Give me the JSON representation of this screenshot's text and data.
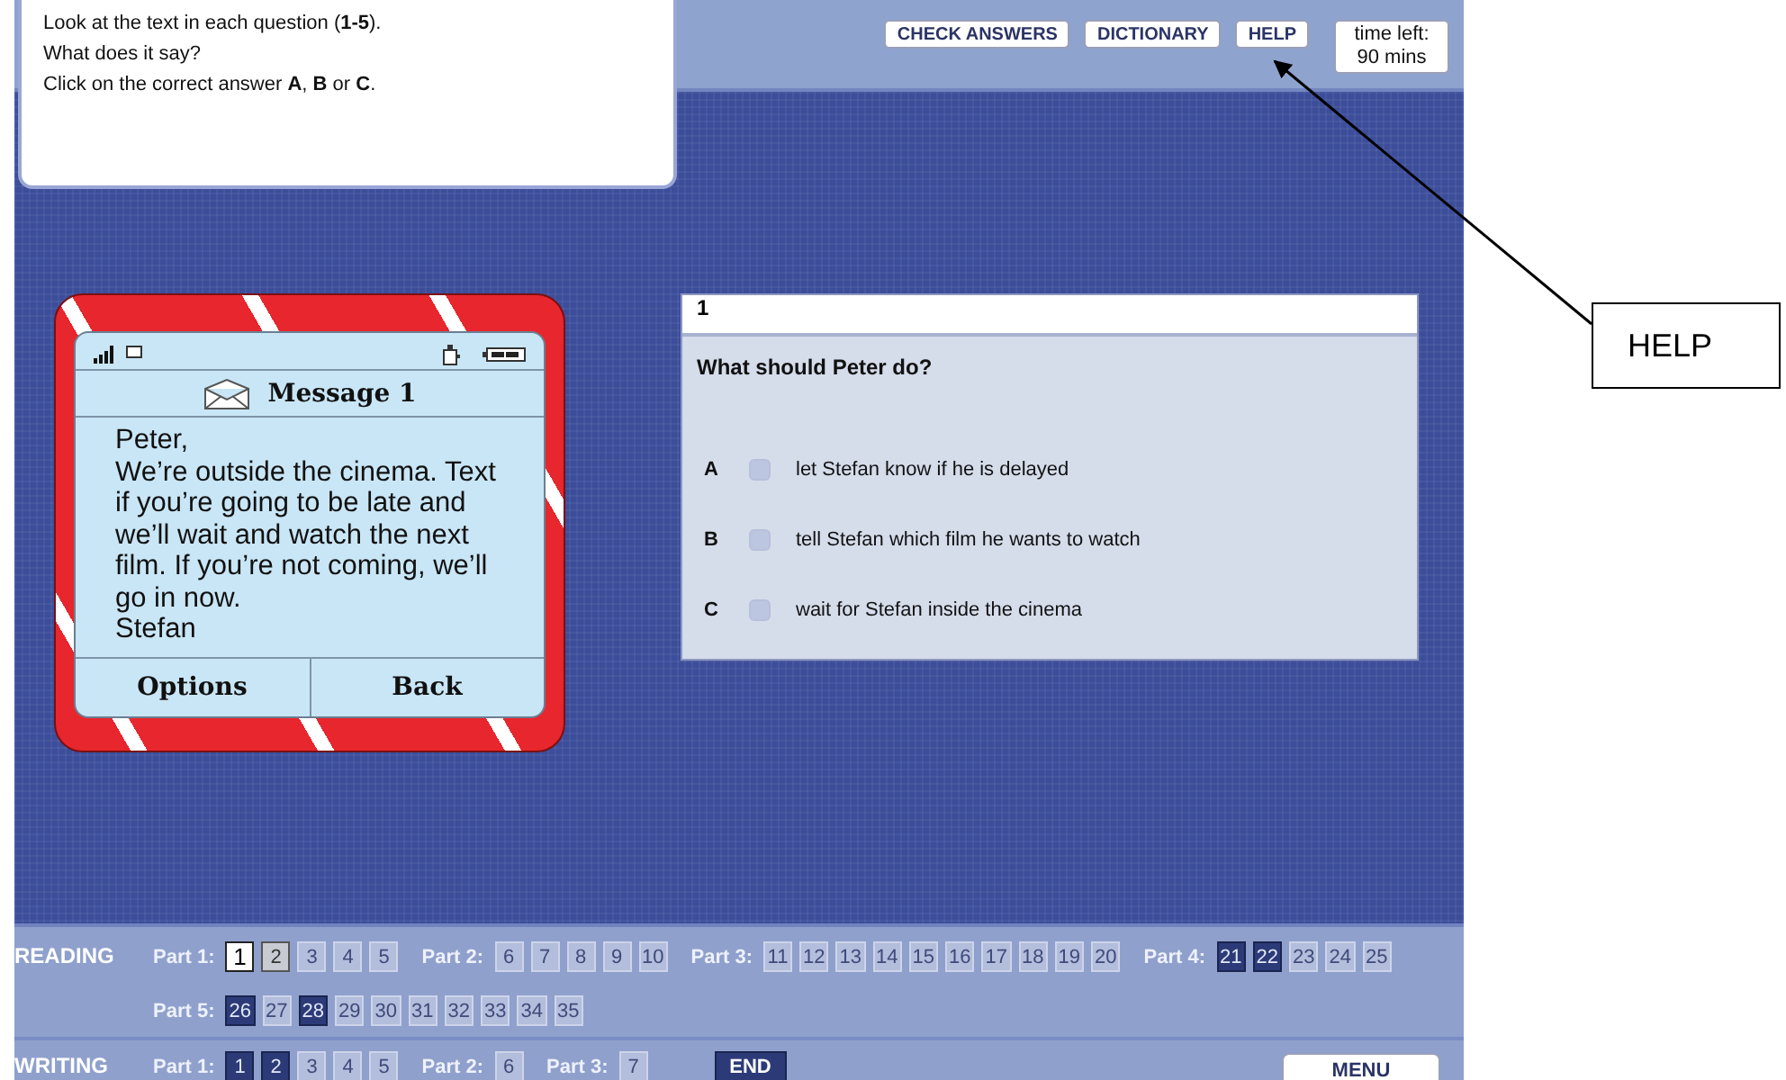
{
  "instructions": [
    "Look at the text in each question (**1-5**).",
    "What does it say?",
    "Click on the correct answer **A**, **B** or **C**."
  ],
  "toolbar": {
    "buttons": [
      "CHECK ANSWERS",
      "DICTIONARY",
      "HELP"
    ],
    "timer": [
      "time left:",
      "90 mins"
    ]
  },
  "phone": {
    "title": "Message 1",
    "message": [
      "Peter,",
      "We’re outside the cinema. Text if you’re going to be late and we’ll wait and watch the next film. If you’re not coming, we’ll go in now.",
      "Stefan"
    ],
    "softkeys": [
      "Options",
      "Back"
    ]
  },
  "question": {
    "number": "1",
    "prompt": "What should Peter do?",
    "options": [
      {
        "letter": "A",
        "text": "let Stefan know if he is delayed",
        "selected": false
      },
      {
        "letter": "B",
        "text": "tell Stefan which film he wants to watch",
        "selected": false
      },
      {
        "letter": "C",
        "text": "wait for Stefan inside the cinema",
        "selected": false
      }
    ]
  },
  "navigation": {
    "reading": {
      "label": "READING",
      "parts": [
        {
          "label": "Part 1:",
          "items": [
            {
              "n": "1",
              "selected": true,
              "visited": true,
              "answered": false
            },
            {
              "n": "2",
              "selected": false,
              "visited": true,
              "answered": false
            },
            {
              "n": "3",
              "selected": false,
              "visited": false,
              "answered": false
            },
            {
              "n": "4",
              "selected": false,
              "visited": false,
              "answered": false
            },
            {
              "n": "5",
              "selected": false,
              "visited": false,
              "answered": false
            }
          ]
        },
        {
          "label": "Part 2:",
          "items": [
            {
              "n": "6",
              "selected": false,
              "visited": false,
              "answered": false
            },
            {
              "n": "7",
              "selected": false,
              "visited": false,
              "answered": false
            },
            {
              "n": "8",
              "selected": false,
              "visited": false,
              "answered": false
            },
            {
              "n": "9",
              "selected": false,
              "visited": false,
              "answered": false
            },
            {
              "n": "10",
              "selected": false,
              "visited": false,
              "answered": false
            }
          ]
        },
        {
          "label": "Part 3:",
          "items": [
            {
              "n": "11",
              "selected": false,
              "visited": false,
              "answered": false
            },
            {
              "n": "12",
              "selected": false,
              "visited": false,
              "answered": false
            },
            {
              "n": "13",
              "selected": false,
              "visited": false,
              "answered": false
            },
            {
              "n": "14",
              "selected": false,
              "visited": false,
              "answered": false
            },
            {
              "n": "15",
              "selected": false,
              "visited": false,
              "answered": false
            },
            {
              "n": "16",
              "selected": false,
              "visited": false,
              "answered": false
            },
            {
              "n": "17",
              "selected": false,
              "visited": false,
              "answered": false
            },
            {
              "n": "18",
              "selected": false,
              "visited": false,
              "answered": false
            },
            {
              "n": "19",
              "selected": false,
              "visited": false,
              "answered": false
            },
            {
              "n": "20",
              "selected": false,
              "visited": false,
              "answered": false
            }
          ]
        },
        {
          "label": "Part 4:",
          "items": [
            {
              "n": "21",
              "selected": false,
              "visited": true,
              "answered": true
            },
            {
              "n": "22",
              "selected": false,
              "visited": true,
              "answered": true
            },
            {
              "n": "23",
              "selected": false,
              "visited": false,
              "answered": false
            },
            {
              "n": "24",
              "selected": false,
              "visited": false,
              "answered": false
            },
            {
              "n": "25",
              "selected": false,
              "visited": false,
              "answered": false
            }
          ]
        },
        {
          "label": "Part 5:",
          "items": [
            {
              "n": "26",
              "selected": false,
              "visited": true,
              "answered": true
            },
            {
              "n": "27",
              "selected": false,
              "visited": false,
              "answered": false
            },
            {
              "n": "28",
              "selected": false,
              "visited": true,
              "answered": true
            },
            {
              "n": "29",
              "selected": false,
              "visited": false,
              "answered": false
            },
            {
              "n": "30",
              "selected": false,
              "visited": false,
              "answered": false
            },
            {
              "n": "31",
              "selected": false,
              "visited": false,
              "answered": false
            },
            {
              "n": "32",
              "selected": false,
              "visited": false,
              "answered": false
            },
            {
              "n": "33",
              "selected": false,
              "visited": false,
              "answered": false
            },
            {
              "n": "34",
              "selected": false,
              "visited": false,
              "answered": false
            },
            {
              "n": "35",
              "selected": false,
              "visited": false,
              "answered": false
            }
          ]
        }
      ]
    },
    "writing": {
      "label": "WRITING",
      "parts": [
        {
          "label": "Part 1:",
          "items": [
            {
              "n": "1",
              "selected": false,
              "visited": true,
              "answered": true
            },
            {
              "n": "2",
              "selected": false,
              "visited": true,
              "answered": true
            },
            {
              "n": "3",
              "selected": false,
              "visited": false,
              "answered": false
            },
            {
              "n": "4",
              "selected": false,
              "visited": false,
              "answered": false
            },
            {
              "n": "5",
              "selected": false,
              "visited": false,
              "answered": false
            }
          ]
        },
        {
          "label": "Part 2:",
          "items": [
            {
              "n": "6",
              "selected": false,
              "visited": false,
              "answered": false
            }
          ]
        },
        {
          "label": "Part 3:",
          "items": [
            {
              "n": "7",
              "selected": false,
              "visited": false,
              "answered": false
            }
          ]
        }
      ],
      "end_button": "END"
    },
    "menu_button": "MENU"
  },
  "annotation": {
    "label": "HELP"
  }
}
